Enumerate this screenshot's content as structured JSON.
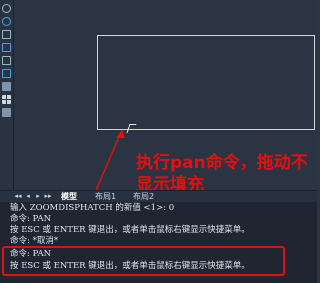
{
  "toolbar": {
    "icons": [
      "refresh-icon",
      "rotate-icon",
      "copy-icon",
      "node-icon",
      "select-icon",
      "layer-icon",
      "fill-icon",
      "grid-icon",
      "image-icon"
    ]
  },
  "annotation": {
    "text": "执行pan命令，拖动不显示填充",
    "color": "#e60f0f"
  },
  "tabs": {
    "nav": [
      "◂◂",
      "◂",
      "▸",
      "▸▸"
    ],
    "items": [
      "模型",
      "布局1",
      "布局2"
    ]
  },
  "command": {
    "lines": [
      "输入 ZOOMDISPHATCH 的新值 <1>: 0",
      "命令: PAN",
      "按 ESC 或 ENTER 键退出，或者单击鼠标右键显示快捷菜单。",
      "命令: *取消*",
      "命令: PAN",
      "按 ESC 或 ENTER 键退出，或者单击鼠标右键显示快捷菜单。"
    ]
  },
  "colors": {
    "background": "#2c3543",
    "command_bg": "#1f2631",
    "highlight": "#e60f0f"
  }
}
